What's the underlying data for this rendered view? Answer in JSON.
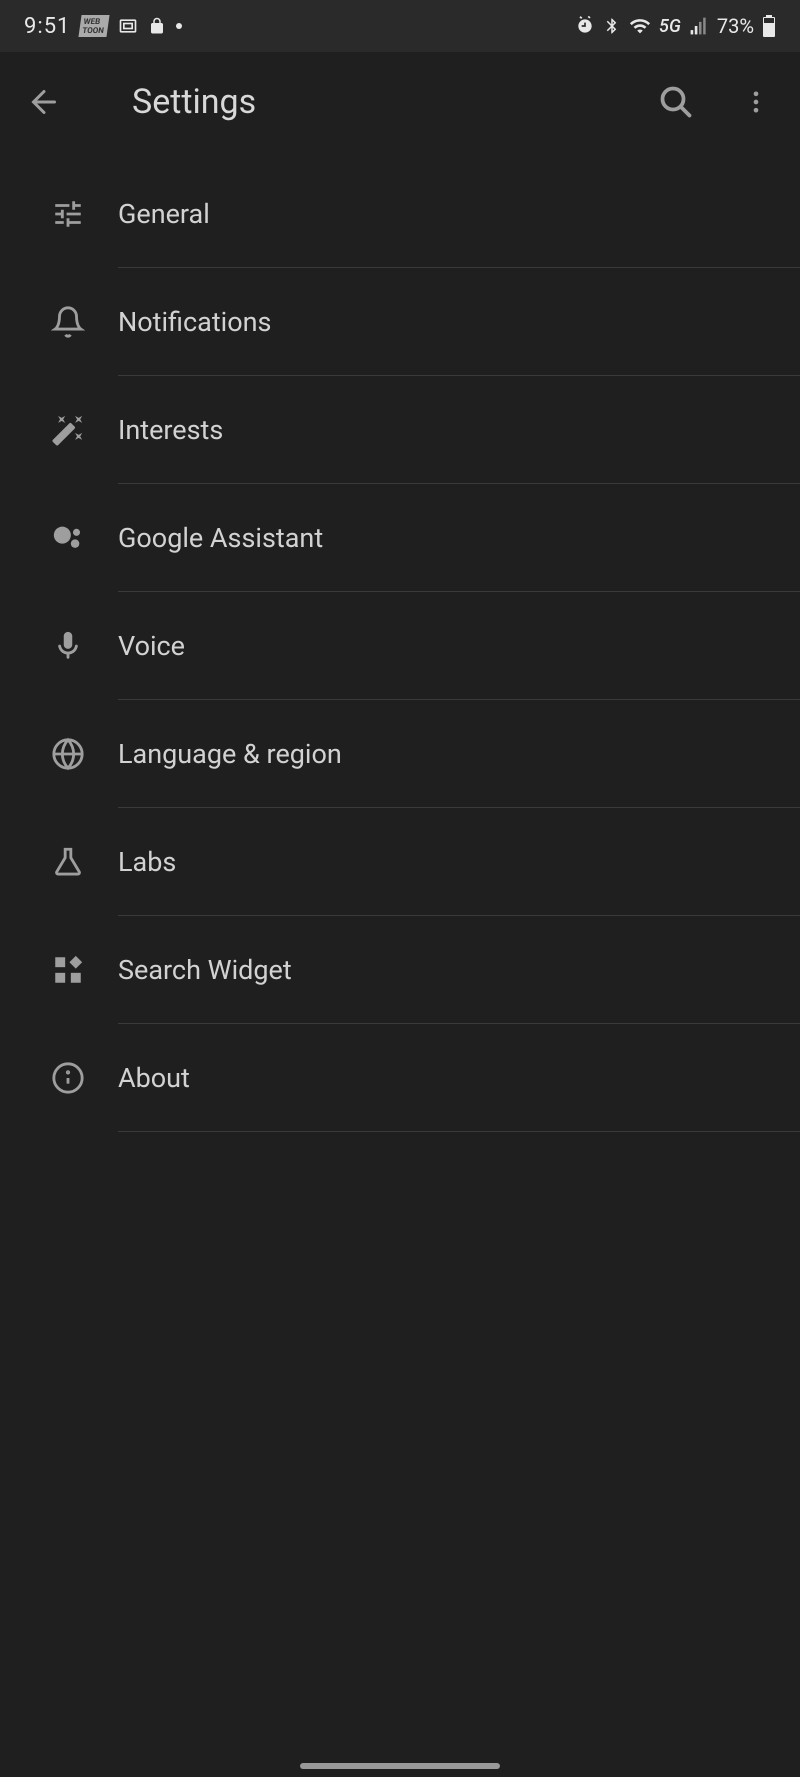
{
  "status_bar": {
    "time": "9:51",
    "battery": "73%",
    "network": "5G"
  },
  "app_bar": {
    "title": "Settings"
  },
  "settings": {
    "items": [
      {
        "label": "General",
        "icon": "tune-icon"
      },
      {
        "label": "Notifications",
        "icon": "bell-icon"
      },
      {
        "label": "Interests",
        "icon": "wand-icon"
      },
      {
        "label": "Google Assistant",
        "icon": "assistant-icon"
      },
      {
        "label": "Voice",
        "icon": "mic-icon"
      },
      {
        "label": "Language & region",
        "icon": "globe-icon"
      },
      {
        "label": "Labs",
        "icon": "flask-icon"
      },
      {
        "label": "Search Widget",
        "icon": "widget-icon"
      },
      {
        "label": "About",
        "icon": "info-icon"
      }
    ]
  }
}
